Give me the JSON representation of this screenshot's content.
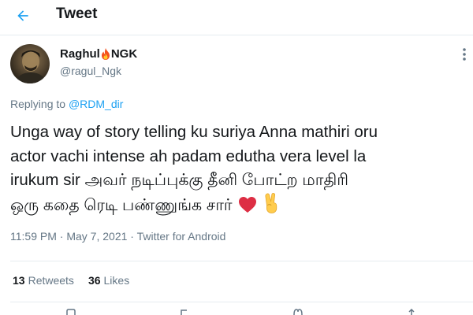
{
  "header": {
    "title": "Tweet",
    "back_icon": "back-arrow-icon"
  },
  "author": {
    "name_part1": "Raghul",
    "name_emoji": "fire-icon",
    "name_part2": "NGK",
    "handle": "@ragul_Ngk"
  },
  "reply": {
    "prefix": "Replying to",
    "mention": "@RDM_dir"
  },
  "tweet": {
    "lines": [
      "Unga way of story telling ku suriya Anna mathiri oru",
      "actor vachi intense ah padam edutha vera level la",
      "irukum sir அவர் நடிப்புக்கு தீனி போட்ற மாதிரி",
      "ஒரு கதை ரெடி பண்ணுங்க சார்"
    ],
    "emojis": [
      "red-heart-icon",
      "victory-hand-icon"
    ]
  },
  "meta": {
    "time": "11:59 PM",
    "date": "May 7, 2021",
    "source": "Twitter for Android",
    "separator": " · "
  },
  "stats": {
    "retweets_count": "13",
    "retweets_label": "Retweets",
    "likes_count": "36",
    "likes_label": "Likes"
  },
  "colors": {
    "accent": "#1da1f2",
    "muted": "#657786",
    "heart": "#e0245e"
  }
}
